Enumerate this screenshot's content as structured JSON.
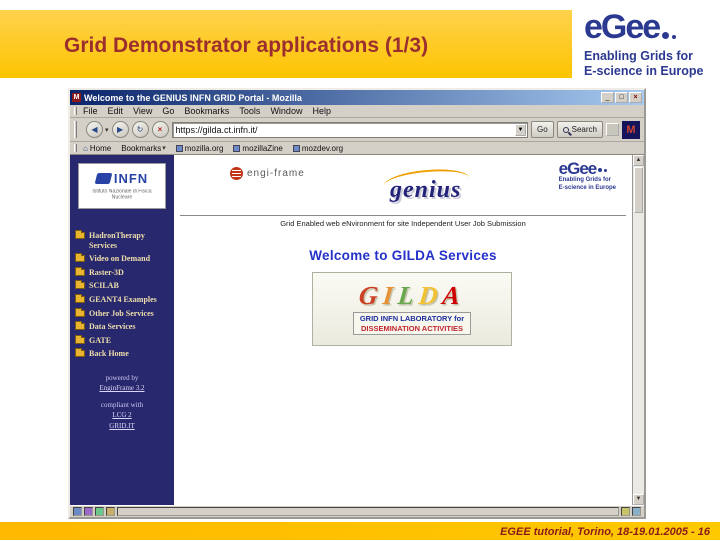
{
  "slide": {
    "title": "Grid Demonstrator applications (1/3)",
    "footer": "EGEE tutorial, Torino, 18-19.01.2005  - 16"
  },
  "egee": {
    "wordmark": "eGee",
    "tagline1": "Enabling Grids for",
    "tagline2": "E-science in Europe"
  },
  "icons": {
    "minimize": "_",
    "maximize": "□",
    "close": "×",
    "back": "◀",
    "caret": "▾",
    "forward": "▶",
    "reload": "↻",
    "stop": "×",
    "home": "⌂",
    "up": "▲",
    "down": "▼",
    "throbber": "M",
    "app": "M"
  },
  "browser": {
    "title": "Welcome to the GENIUS INFN GRID Portal - Mozilla",
    "menu": [
      "File",
      "Edit",
      "View",
      "Go",
      "Bookmarks",
      "Tools",
      "Window",
      "Help"
    ],
    "nav": {
      "url": "https://gilda.ct.infn.it/",
      "go": "Go",
      "search": "Search"
    },
    "personal_bar": [
      "Home",
      "Bookmarks",
      "mozilla.org",
      "mozillaZine",
      "mozdev.org"
    ],
    "sidebar": {
      "infn": "INFN",
      "infn_sub": "Istituto Nazionale di Fisica Nucleare",
      "items": [
        "HadronTherapy Services",
        "Video on Demand",
        "Raster-3D",
        "SCILAB",
        "GEANT4 Examples",
        "Other Job Services",
        "Data Services",
        "GATE",
        "Back Home"
      ],
      "powered_by": "powered by",
      "enginframe": "EnginFrame 3.2",
      "compliant": "compliant with",
      "lcg": "LCG 2",
      "gridit": "GRID.IT"
    },
    "main": {
      "enginframe_logo": "engi-frame",
      "genius": "genius",
      "egee_wordmark": "eGee",
      "egee_tag1": "Enabling Grids for",
      "egee_tag2": "E-science in Europe",
      "banner": "Grid Enabled web eNvironment for site Independent User Job Submission",
      "welcome": "Welcome to GILDA Services",
      "gilda_letters": [
        "G",
        "I",
        "L",
        "D",
        "A"
      ],
      "gilda_caption1": "GRID INFN LABORATORY for",
      "gilda_caption2": "DISSEMINATION ACTIVITIES"
    }
  }
}
